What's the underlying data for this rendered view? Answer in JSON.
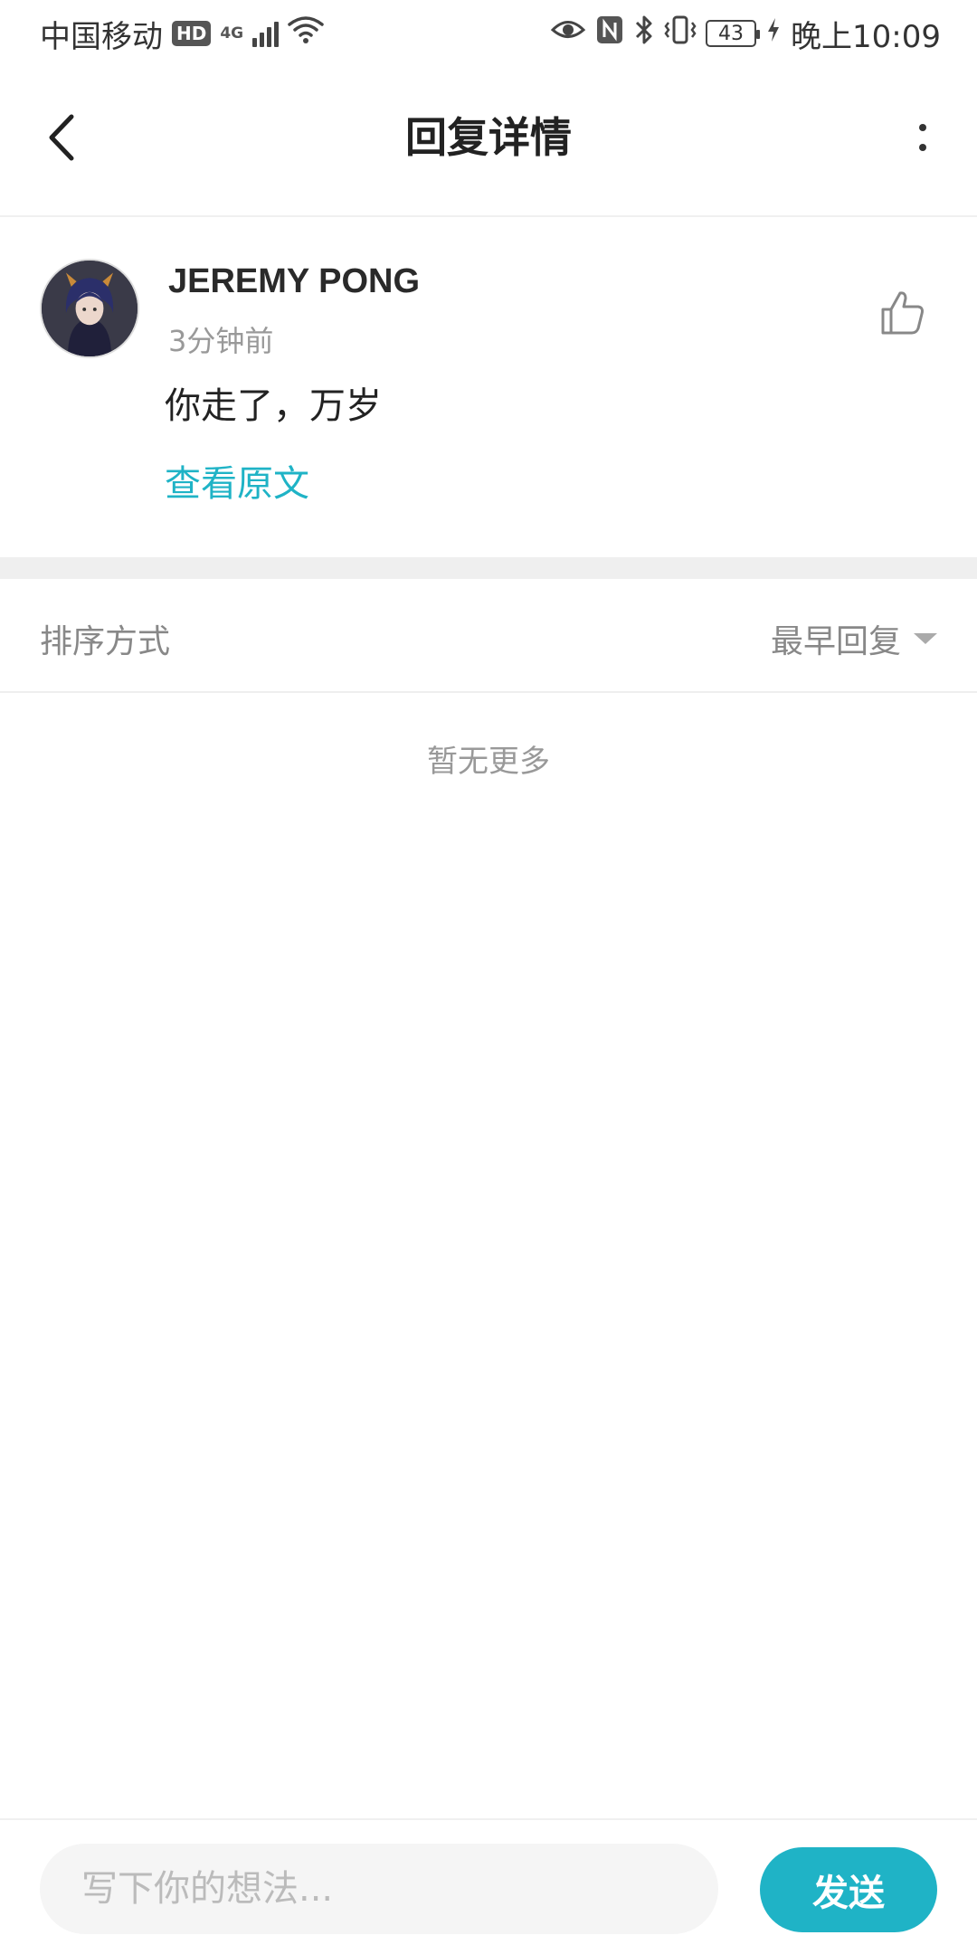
{
  "status_bar": {
    "carrier": "中国移动",
    "hd_badge": "HD",
    "network_type": "4G",
    "battery_level": "43",
    "time": "晚上10:09",
    "icons": [
      "hd-icon",
      "signal-icon",
      "wifi-icon",
      "eye-icon",
      "nfc-icon",
      "bluetooth-icon",
      "vibrate-icon",
      "battery-icon",
      "charging-icon"
    ]
  },
  "header": {
    "title": "回复详情",
    "back_icon": "chevron-left-icon",
    "more_icon": "more-vertical-icon"
  },
  "comment": {
    "username": "JEREMY PONG",
    "timestamp": "3分钟前",
    "text": "你走了，万岁",
    "view_original_label": "查看原文",
    "like_icon": "thumbs-up-icon"
  },
  "sort": {
    "label": "排序方式",
    "selected_option": "最早回复"
  },
  "empty_state": {
    "text": "暂无更多"
  },
  "composer": {
    "placeholder": "写下你的想法...",
    "send_label": "发送"
  },
  "colors": {
    "accent": "#1fb3c6",
    "divider": "#efefef",
    "muted_text": "#999999"
  }
}
